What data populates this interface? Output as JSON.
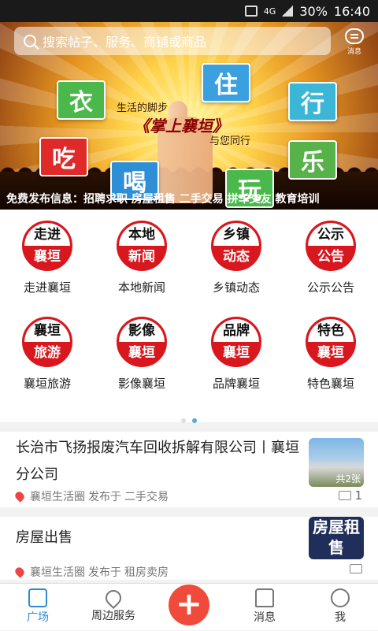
{
  "status_bar": {
    "signal": "4G",
    "battery": "30%",
    "time": "16:40"
  },
  "search": {
    "placeholder": "搜索帖子、服务、商铺或商品"
  },
  "message_button": {
    "label": "消息"
  },
  "banner": {
    "tiles": {
      "clothes": "衣",
      "live": "住",
      "travel": "行",
      "eat": "吃",
      "drink": "喝",
      "play": "玩",
      "happy": "乐"
    },
    "slogan_top": "生活的脚步",
    "slogan_main": "《掌上襄垣》",
    "slogan_sub": "与您同行",
    "ticker": "免费发布信息：招聘求职 房屋租售 二手交易 拼车交友 教育培训"
  },
  "grid": [
    {
      "badge_top": "走进",
      "badge_bottom": "襄垣",
      "label": "走进襄垣"
    },
    {
      "badge_top": "本地",
      "badge_bottom": "新闻",
      "label": "本地新闻"
    },
    {
      "badge_top": "乡镇",
      "badge_bottom": "动态",
      "label": "乡镇动态"
    },
    {
      "badge_top": "公示",
      "badge_bottom": "公告",
      "label": "公示公告"
    },
    {
      "badge_top": "襄垣",
      "badge_bottom": "旅游",
      "label": "襄垣旅游"
    },
    {
      "badge_top": "影像",
      "badge_bottom": "襄垣",
      "label": "影像襄垣"
    },
    {
      "badge_top": "品牌",
      "badge_bottom": "襄垣",
      "label": "品牌襄垣"
    },
    {
      "badge_top": "特色",
      "badge_bottom": "襄垣",
      "label": "特色襄垣"
    }
  ],
  "feed": [
    {
      "title": "长治市飞扬报废汽车回收拆解有限公司丨襄垣分公司",
      "source": "襄垣生活圈",
      "published": "发布于",
      "category": "二手交易",
      "comments": "1",
      "thumb_caption": "共2张"
    },
    {
      "title": "房屋出售",
      "source": "襄垣生活圈",
      "published": "发布于",
      "category": "租房卖房",
      "comments": "",
      "thumb_caption": "房屋租售"
    }
  ],
  "tabbar": {
    "plaza": "广场",
    "nearby": "周边服务",
    "add": "+",
    "messages": "消息",
    "me": "我"
  },
  "colors": {
    "accent": "#2b8bd6",
    "badge_red": "#d9171e",
    "add_red": "#f04a3a"
  }
}
